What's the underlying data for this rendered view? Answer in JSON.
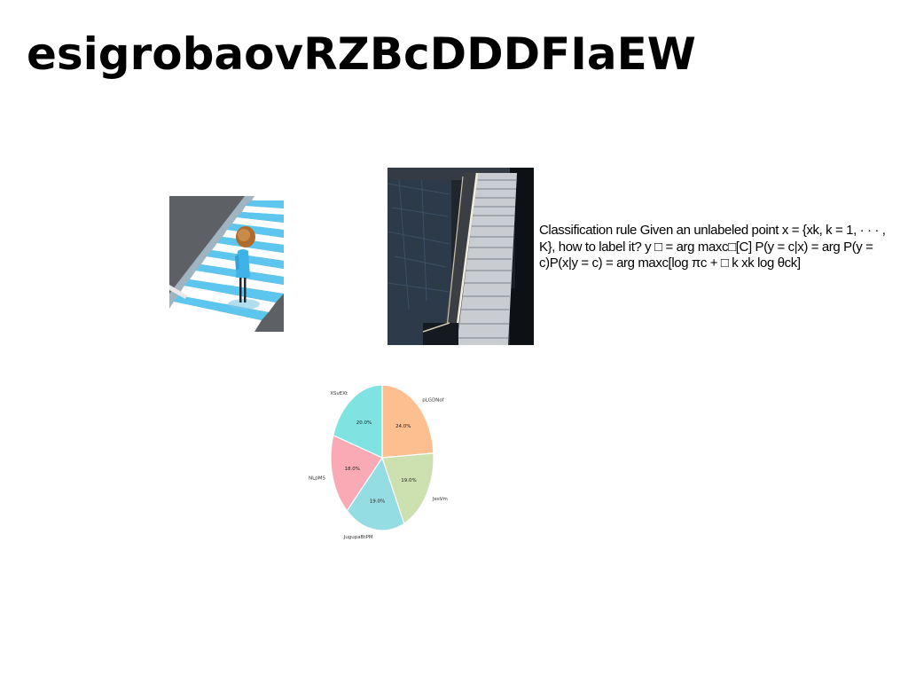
{
  "page": {
    "title": "esigrobaovRZBcDDDFIaEW",
    "paragraph": "Classification rule Given an unlabeled point x = {xk, k = 1, · · · , K}, how to label it? y □ = arg maxc□[C] P(y = c|x) = arg P(y = c)P(x|y = c) = arg maxc[log πc + □ k xk log θck]"
  },
  "images": {
    "crosswalk": {
      "name": "crosswalk-umbrella-photo"
    },
    "staircase": {
      "name": "staircase-photo"
    }
  },
  "chart_data": {
    "type": "pie",
    "slices": [
      {
        "label": "pLGDNof",
        "value": 24.0,
        "pct_label": "24.0%",
        "color": "#fdbf8f"
      },
      {
        "label": "JesVm",
        "value": 19.0,
        "pct_label": "19.0%",
        "color": "#cce0b0"
      },
      {
        "label": "JugupaBtPM",
        "value": 19.0,
        "pct_label": "19.0%",
        "color": "#94dde2"
      },
      {
        "label": "NLpMS",
        "value": 18.0,
        "pct_label": "18.0%",
        "color": "#f9aab4"
      },
      {
        "label": "XSvEXt",
        "value": 20.0,
        "pct_label": "20.0%",
        "color": "#7fe3e1"
      }
    ],
    "start": "top",
    "direction": "clockwise"
  }
}
